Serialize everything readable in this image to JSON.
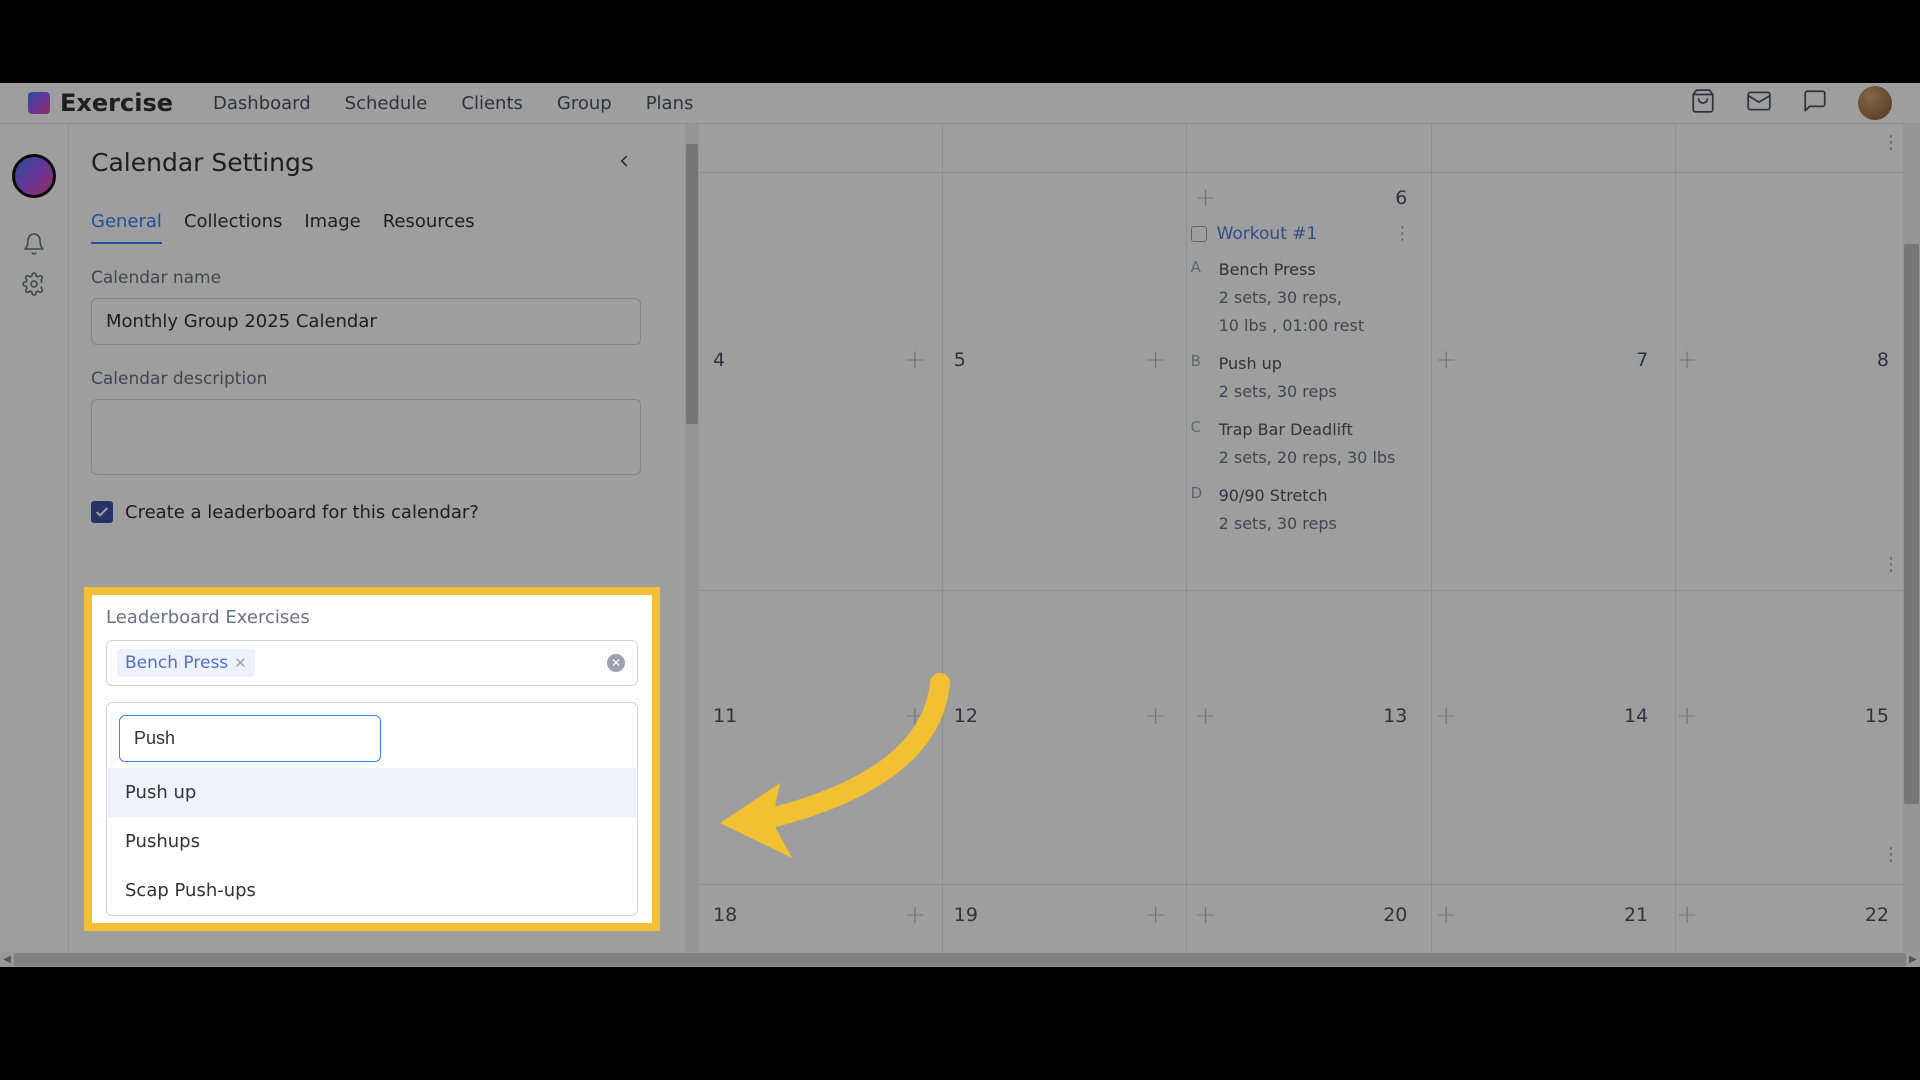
{
  "brand": "Exercise",
  "nav": {
    "dashboard": "Dashboard",
    "schedule": "Schedule",
    "clients": "Clients",
    "group": "Group",
    "plans": "Plans"
  },
  "panel_title": "Calendar Settings",
  "tabs": {
    "general": "General",
    "collections": "Collections",
    "image": "Image",
    "resources": "Resources"
  },
  "labels": {
    "calendar_name": "Calendar name",
    "calendar_description": "Calendar description",
    "leaderboard_checkbox": "Create a leaderboard for this calendar?",
    "leaderboard_exercises": "Leaderboard Exercises"
  },
  "form": {
    "calendar_name_value": "Monthly Group 2025 Calendar",
    "calendar_description_value": ""
  },
  "leaderboard": {
    "selected_tag": "Bench Press",
    "search_value": "Push",
    "options": {
      "opt0": "Push up",
      "opt1": "Pushups",
      "opt2": "Scap Push-ups"
    }
  },
  "calendar": {
    "row1": {
      "d0": "4",
      "d1": "5",
      "d2": "6",
      "d3": "7",
      "d4": "8"
    },
    "row2": {
      "d0": "11",
      "d1": "12",
      "d2": "13",
      "d3": "14",
      "d4": "15"
    },
    "row3": {
      "d0": "18",
      "d1": "19",
      "d2": "20",
      "d3": "21",
      "d4": "22"
    }
  },
  "workout": {
    "title": "Workout #1",
    "items": {
      "a": {
        "letter": "A",
        "name": "Bench Press",
        "detail1": "2 sets, 30 reps,",
        "detail2": "10 lbs , 01:00 rest"
      },
      "b": {
        "letter": "B",
        "name": "Push up",
        "detail1": "2 sets, 30 reps"
      },
      "c": {
        "letter": "C",
        "name": "Trap Bar Deadlift",
        "detail1": "2 sets, 20 reps, 30 lbs"
      },
      "d": {
        "letter": "D",
        "name": "90/90 Stretch",
        "detail1": "2 sets, 30 reps"
      }
    }
  }
}
